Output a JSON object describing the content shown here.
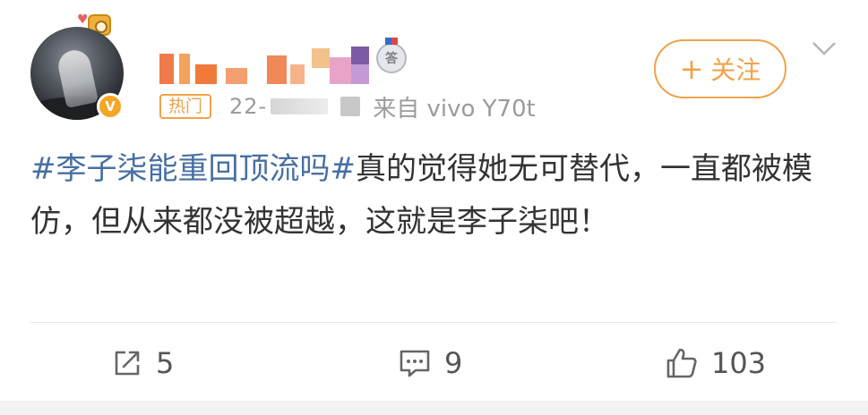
{
  "post": {
    "hot_tag": "热门",
    "date": "22-",
    "source": "来自 vivo Y70t",
    "follow_label": "关注",
    "medal_text": "答",
    "topic": "#李子柒能重回顶流吗#",
    "body": "真的觉得她无可替代，一直都被模仿，但从来都没被超越，这就是李子柒吧！"
  },
  "actions": {
    "repost_count": "5",
    "comment_count": "9",
    "like_count": "103"
  },
  "colors": {
    "accent": "#f0a24a",
    "topic": "#476fa1",
    "verified": "#f5a623"
  },
  "icons": {
    "repost": "share-square-icon",
    "comment": "comment-bubble-icon",
    "like": "thumbs-up-icon",
    "more": "chevron-down-icon",
    "verified": "verified-badge-icon"
  }
}
